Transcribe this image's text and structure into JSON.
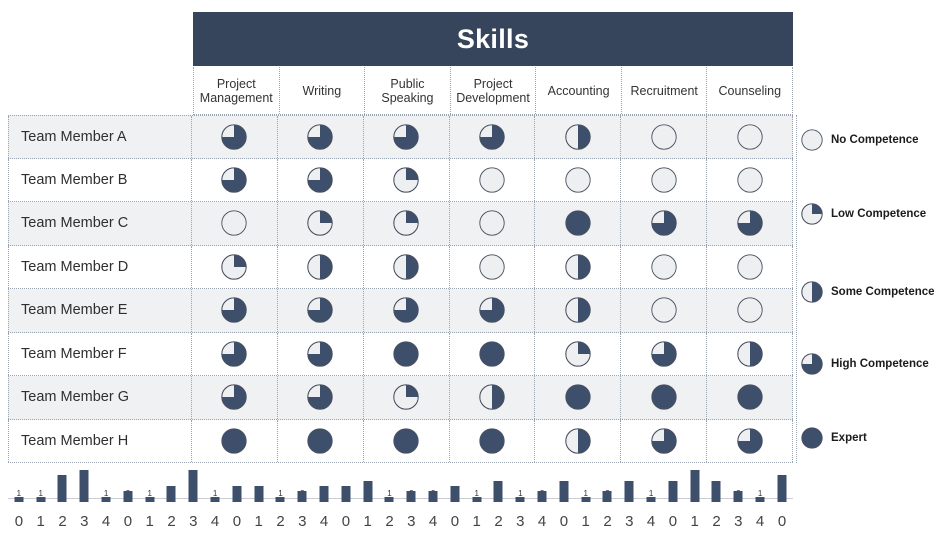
{
  "banner": {
    "title": "Skills"
  },
  "columns": [
    "Project Management",
    "Writing",
    "Public Speaking",
    "Project Development",
    "Accounting",
    "Recruitment",
    "Counseling"
  ],
  "rows": [
    "Team Member A",
    "Team Member B",
    "Team Member C",
    "Team Member D",
    "Team Member E",
    "Team Member F",
    "Team Member G",
    "Team Member H"
  ],
  "legend": {
    "items": [
      {
        "level": 0,
        "label": "No Competence"
      },
      {
        "level": 1,
        "label": "Low Competence"
      },
      {
        "level": 2,
        "label": "Some Competence"
      },
      {
        "level": 3,
        "label": "High  Competence"
      },
      {
        "level": 4,
        "label": "Expert"
      }
    ]
  },
  "colors": {
    "fill": "#3d4f6b",
    "empty": "#eeeff0",
    "stroke": "#4a5160",
    "banner": "#36455c",
    "row_alt": "#f0f1f2",
    "grid": "#9aa3b0"
  },
  "chart_data": {
    "type": "heatmap",
    "title": "Skills",
    "row_label_header": "",
    "categories": [
      "Project Management",
      "Writing",
      "Public Speaking",
      "Project Development",
      "Accounting",
      "Recruitment",
      "Counseling"
    ],
    "rows": [
      "Team Member A",
      "Team Member B",
      "Team Member C",
      "Team Member D",
      "Team Member E",
      "Team Member F",
      "Team Member G",
      "Team Member H"
    ],
    "scale": {
      "0": "No Competence",
      "1": "Low Competence",
      "2": "Some Competence",
      "3": "High Competence",
      "4": "Expert"
    },
    "values": [
      [
        3,
        3,
        3,
        3,
        2,
        0,
        0
      ],
      [
        3,
        3,
        1,
        0,
        0,
        0,
        0
      ],
      [
        0,
        1,
        1,
        0,
        4,
        3,
        3
      ],
      [
        1,
        2,
        2,
        0,
        2,
        0,
        0
      ],
      [
        3,
        3,
        3,
        3,
        2,
        0,
        0
      ],
      [
        3,
        3,
        4,
        4,
        1,
        3,
        2
      ],
      [
        3,
        3,
        1,
        2,
        4,
        4,
        4
      ],
      [
        4,
        4,
        4,
        4,
        2,
        3,
        3
      ]
    ]
  },
  "histograms": {
    "bins": [
      0,
      1,
      2,
      3,
      4
    ],
    "groups": [
      {
        "skill": "Project Management",
        "counts": [
          1,
          1,
          5,
          6,
          1
        ]
      },
      {
        "skill": "Writing",
        "counts": [
          2,
          1,
          3,
          6,
          1
        ]
      },
      {
        "skill": "Public Speaking",
        "counts": [
          3,
          3,
          1,
          2,
          3
        ]
      },
      {
        "skill": "Project Development",
        "counts": [
          3,
          4,
          1,
          2,
          2
        ]
      },
      {
        "skill": "Accounting",
        "counts": [
          3,
          1,
          4,
          1,
          2
        ]
      },
      {
        "skill": "Recruitment",
        "counts": [
          4,
          1,
          2,
          4,
          1
        ]
      },
      {
        "skill": "Counseling",
        "counts": [
          4,
          6,
          4,
          2,
          1
        ]
      }
    ],
    "trailing_tick": {
      "label": "0",
      "count": 5
    }
  }
}
